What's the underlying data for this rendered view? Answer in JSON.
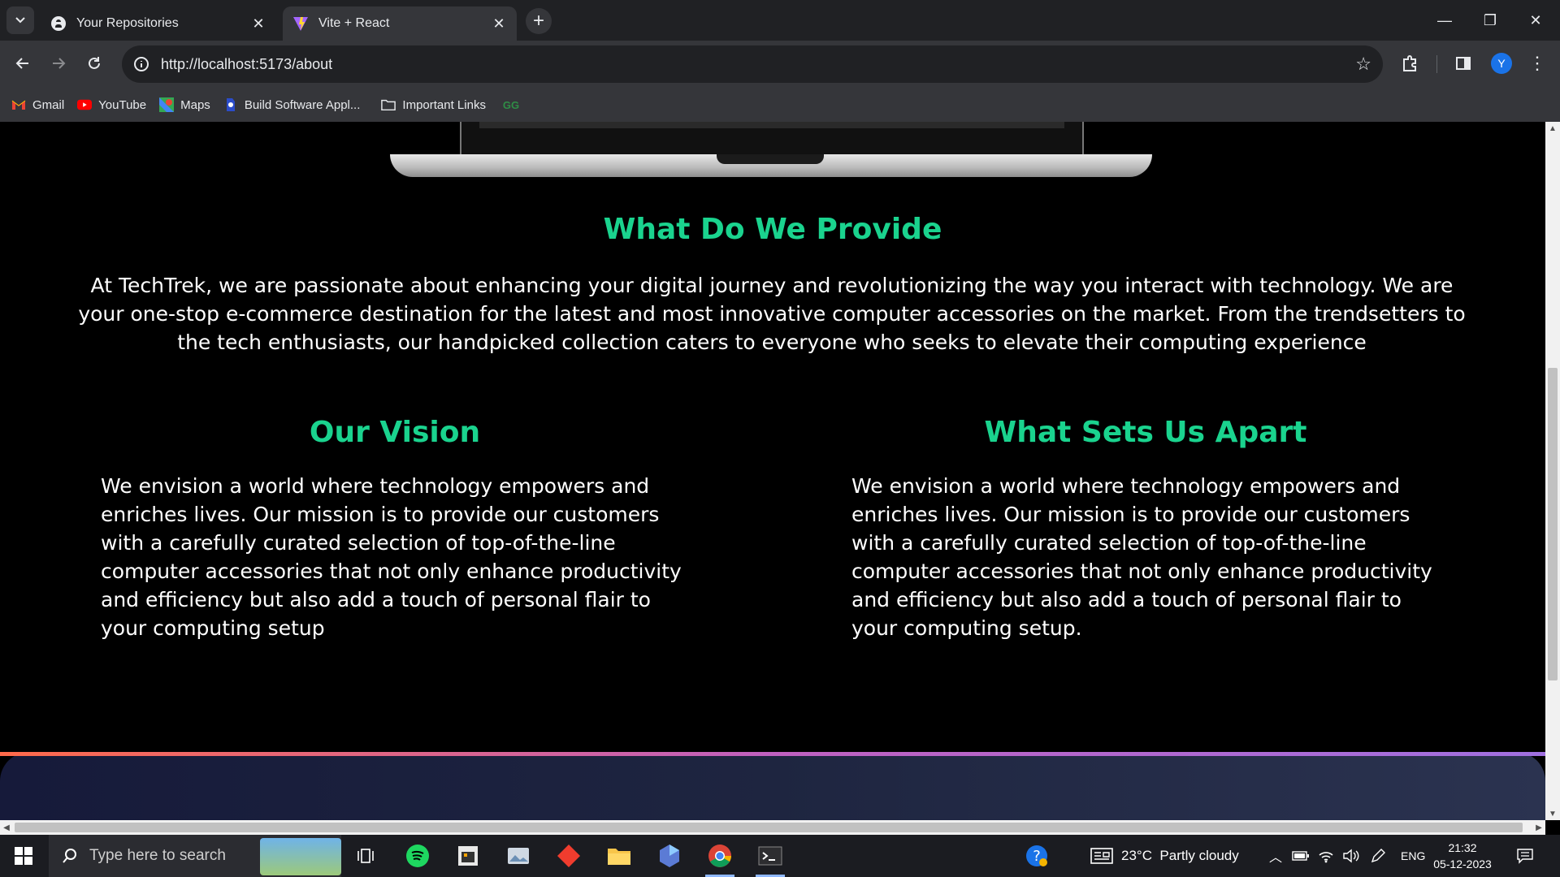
{
  "browser": {
    "tabs": [
      {
        "title": "Your Repositories",
        "favicon": "github-icon",
        "active": false
      },
      {
        "title": "Vite + React",
        "favicon": "vite-icon",
        "active": true
      }
    ],
    "url": "http://localhost:5173/about",
    "profile_initial": "Y",
    "bookmarks": [
      {
        "label": "Gmail",
        "icon": "gmail-icon"
      },
      {
        "label": "YouTube",
        "icon": "youtube-icon"
      },
      {
        "label": "Maps",
        "icon": "maps-icon"
      },
      {
        "label": "Build Software Appl...",
        "icon": "bookmark-site-icon"
      },
      {
        "label": "Important Links",
        "icon": "folder-icon"
      },
      {
        "label": "",
        "icon": "geeksforgeeks-icon"
      }
    ]
  },
  "page": {
    "provide": {
      "heading": "What Do We Provide",
      "text": "At TechTrek, we are passionate about enhancing your digital journey and revolutionizing the way you interact with technology. We are your one-stop e-commerce destination for the latest and most innovative computer accessories on the market. From the trendsetters to the tech enthusiasts, our handpicked collection caters to everyone who seeks to elevate their computing experience"
    },
    "vision": {
      "heading": "Our Vision",
      "text": "We envision a world where technology empowers and enriches lives. Our mission is to provide our customers with a carefully curated selection of top-of-the-line computer accessories that not only enhance productivity and efficiency but also add a touch of personal flair to your computing setup"
    },
    "apart": {
      "heading": "What Sets Us Apart",
      "text": "We envision a world where technology empowers and enriches lives. Our mission is to provide our customers with a carefully curated selection of top-of-the-line computer accessories that not only enhance productivity and efficiency but also add a touch of personal flair to your computing setup."
    }
  },
  "taskbar": {
    "search_placeholder": "Type here to search",
    "weather": "23°C  Partly cloudy",
    "language": "ENG",
    "time": "21:32",
    "date": "05-12-2023"
  },
  "colors": {
    "accent_heading": "#1ad38e",
    "page_bg": "#000000",
    "chrome_bg": "#35363a"
  }
}
